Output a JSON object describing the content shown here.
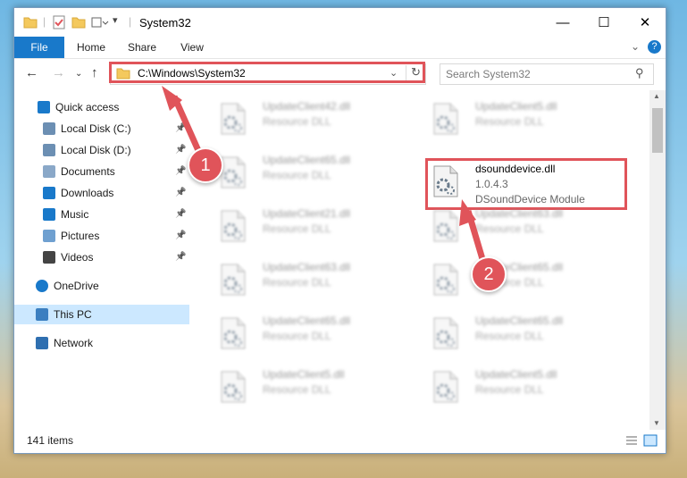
{
  "window": {
    "title": "System32"
  },
  "ribbon": {
    "tabs": [
      "File",
      "Home",
      "Share",
      "View"
    ]
  },
  "address": {
    "path": "C:\\Windows\\System32"
  },
  "search": {
    "placeholder": "Search System32"
  },
  "nav": {
    "items": [
      {
        "label": "Quick access",
        "icon": "star-icon",
        "pinned": false
      },
      {
        "label": "Local Disk (C:)",
        "icon": "drive-icon",
        "pinned": true
      },
      {
        "label": "Local Disk (D:)",
        "icon": "drive-icon",
        "pinned": true
      },
      {
        "label": "Documents",
        "icon": "document-icon",
        "pinned": true
      },
      {
        "label": "Downloads",
        "icon": "download-icon",
        "pinned": true
      },
      {
        "label": "Music",
        "icon": "music-icon",
        "pinned": true
      },
      {
        "label": "Pictures",
        "icon": "picture-icon",
        "pinned": true
      },
      {
        "label": "Videos",
        "icon": "video-icon",
        "pinned": true
      },
      {
        "label": "OneDrive",
        "icon": "cloud-icon",
        "pinned": false
      },
      {
        "label": "This PC",
        "icon": "computer-icon",
        "pinned": false,
        "selected": true
      },
      {
        "label": "Network",
        "icon": "network-icon",
        "pinned": false
      }
    ]
  },
  "files": [
    {
      "name": "UpdateClient42.dll",
      "desc": "Resource DLL"
    },
    {
      "name": "UpdateClient5.dll",
      "desc": "Resource DLL"
    },
    {
      "name": "UpdateClient65.dll",
      "desc": "Resource DLL"
    },
    {
      "name": "dsounddevice.dll",
      "version": "1.0.4.3",
      "desc": "DSoundDevice Module",
      "featured": true
    },
    {
      "name": "UpdateClient21.dll",
      "desc": "Resource DLL"
    },
    {
      "name": "UpdateClient63.dll",
      "desc": "Resource DLL"
    },
    {
      "name": "UpdateClient63.dll",
      "desc": "Resource DLL"
    },
    {
      "name": "UpdateClient65.dll",
      "desc": "Resource DLL"
    },
    {
      "name": "UpdateClient65.dll",
      "desc": "Resource DLL"
    },
    {
      "name": "UpdateClient65.dll",
      "desc": "Resource DLL"
    },
    {
      "name": "UpdateClient5.dll",
      "desc": "Resource DLL"
    },
    {
      "name": "UpdateClient5.dll",
      "desc": "Resource DLL"
    }
  ],
  "status": {
    "count": "141 items"
  },
  "annotations": {
    "marker1": "1",
    "marker2": "2"
  },
  "colors": {
    "accent": "#1979ca",
    "highlight": "#e0545a"
  }
}
